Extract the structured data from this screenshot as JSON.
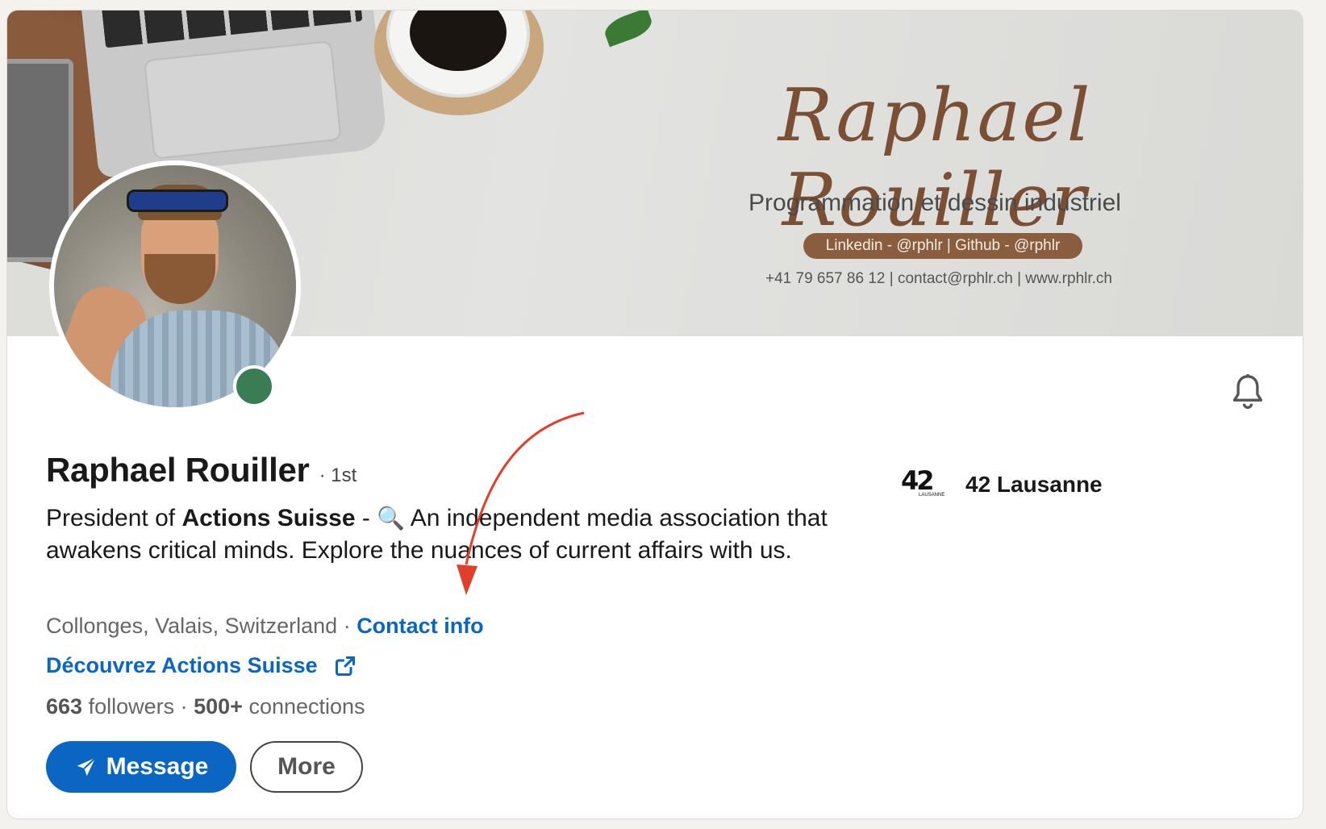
{
  "banner": {
    "script_name": "Raphael Rouiller",
    "subtitle": "Programmation et dessin industriel",
    "pill": "Linkedin - @rphlr  |  Github - @rphlr",
    "contact_line": "+41 79 657 86 12  |  contact@rphlr.ch  |  www.rphlr.ch"
  },
  "profile": {
    "name": "Raphael Rouiller",
    "degree": "· 1st",
    "headline": {
      "prefix": "President of ",
      "org_bold": "Actions Suisse",
      "dash": " - ",
      "emoji": "🔍",
      "rest": " An independent media association that awakens critical minds. Explore the nuances of current affairs with us."
    },
    "location": "Collonges, Valais, Switzerland",
    "separator": " · ",
    "contact_info": "Contact info",
    "website_link": "Découvrez Actions Suisse",
    "followers_count": "663",
    "followers_label": " followers",
    "stats_sep": "  · ",
    "connections_count": "500+",
    "connections_label": " connections",
    "online": true
  },
  "actions": {
    "message_label": "Message",
    "more_label": "More"
  },
  "organization": {
    "logo_text": "42",
    "logo_small": "LAUSANNE",
    "name": "42 Lausanne"
  },
  "icons": {
    "notification": "bell-icon",
    "external_link": "external-link-icon",
    "send": "paper-plane-icon"
  },
  "colors": {
    "link_blue": "#0a66c2",
    "online_green": "#3a7d54",
    "banner_brown": "#7a4f33",
    "annotation_red": "#e0402a"
  }
}
